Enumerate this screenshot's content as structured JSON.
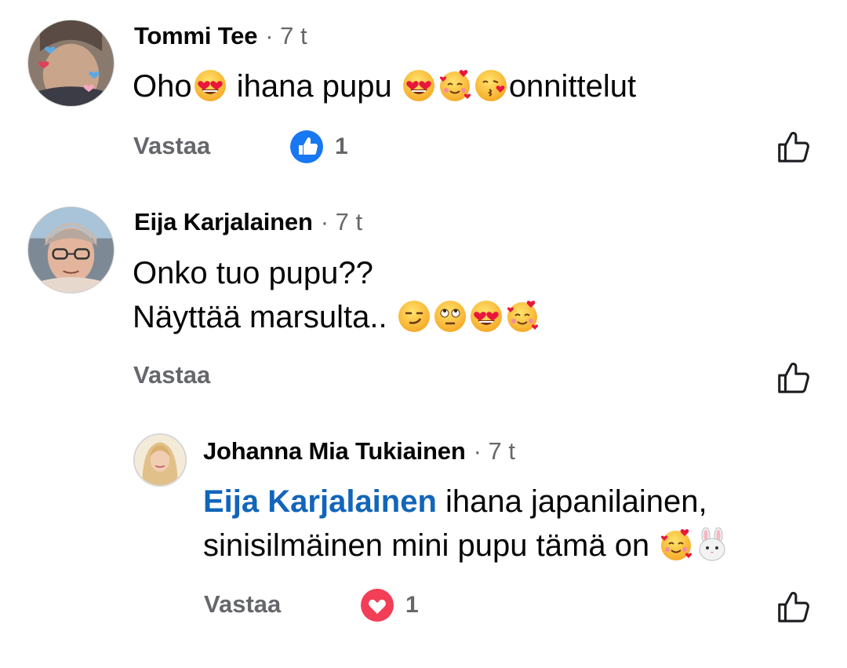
{
  "comments": [
    {
      "author": "Tommi Tee",
      "time": "· 7 t",
      "text_parts": [
        "Oho",
        " ihana pupu ",
        "onnittelut"
      ],
      "reply_label": "Vastaa",
      "reaction": {
        "type": "like",
        "count": "1",
        "color": "#1877f2"
      }
    },
    {
      "author": "Eija Karjalainen",
      "time": "· 7 t",
      "line1": "Onko tuo pupu??",
      "line2": "Näyttää marsulta.. ",
      "reply_label": "Vastaa"
    },
    {
      "author": "Johanna Mia Tukiainen",
      "time": "· 7 t",
      "mention": "Eija Karjalainen",
      "line1_rest": " ihana japanilainen,",
      "line2": "sinisilmäinen mini pupu tämä on ",
      "reply_label": "Vastaa",
      "reaction": {
        "type": "love",
        "count": "1",
        "color": "#f33e58"
      }
    }
  ],
  "emoji_names": [
    "heart-eyes-emoji",
    "smiling-hearts-emoji",
    "kissing-heart-emoji",
    "smirk-emoji",
    "eye-roll-emoji",
    "rabbit-face-emoji"
  ],
  "colors": {
    "mention": "#1265b9",
    "secondary_text": "#65676b",
    "like_blue": "#1877f2",
    "love_red": "#f33e58"
  }
}
